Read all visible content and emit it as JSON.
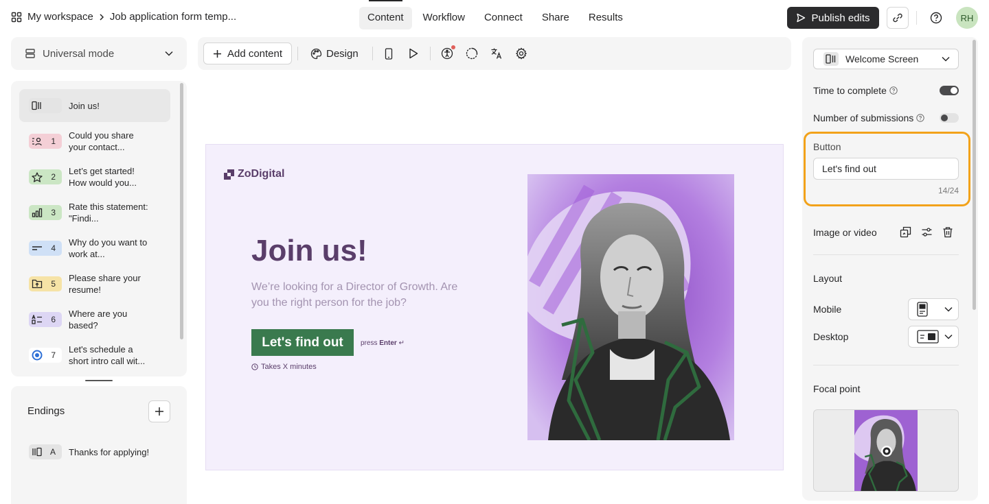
{
  "breadcrumb": {
    "workspace": "My workspace",
    "form": "Job application form temp..."
  },
  "nav": {
    "tabs": [
      "Content",
      "Workflow",
      "Connect",
      "Share",
      "Results"
    ],
    "active": "Content"
  },
  "header": {
    "publish_label": "Publish edits",
    "avatar_initials": "RH"
  },
  "left": {
    "mode_label": "Universal mode",
    "questions": [
      {
        "num": "",
        "text": "Join us!",
        "badge_color": "#e4e4e4",
        "icon": "welcome-screen-icon"
      },
      {
        "num": "1",
        "text": "Could you share your contact...",
        "badge_color": "#f4cfd6",
        "icon": "contact-info-icon"
      },
      {
        "num": "2",
        "text": "Let’s get started! How would you...",
        "badge_color": "#cbe6c4",
        "icon": "star-rating-icon"
      },
      {
        "num": "3",
        "text": "Rate this statement: \"Findi...",
        "badge_color": "#cbe6c4",
        "icon": "opinion-scale-icon"
      },
      {
        "num": "4",
        "text": "Why do you want to work at...",
        "badge_color": "#cfe0f6",
        "icon": "short-text-icon"
      },
      {
        "num": "5",
        "text": "Please share your resume!",
        "badge_color": "#f6e3a6",
        "icon": "file-upload-icon"
      },
      {
        "num": "6",
        "text": "Where are you based?",
        "badge_color": "#ddd6f4",
        "icon": "dropdown-icon"
      },
      {
        "num": "7",
        "text": "Let's schedule a short intro call wit...",
        "badge_color": "#ffffff",
        "icon": "calendly-icon"
      }
    ],
    "endings_title": "Endings",
    "ending": {
      "letter": "A",
      "text": "Thanks for applying!"
    }
  },
  "toolbar": {
    "add_content_label": "Add content",
    "design_label": "Design"
  },
  "canvas": {
    "logo_text": "ZoDigital",
    "headline": "Join us!",
    "subtitle": "We’re looking for a Director of Growth. Are you the right person for the job?",
    "cta_label": "Let's find out",
    "press_prefix": "press",
    "press_key": "Enter",
    "takes_label": "Takes X minutes",
    "background_color": "#f4effc",
    "accent_color": "#5a3e6a",
    "button_color": "#3a7a4e"
  },
  "right": {
    "screen_type": "Welcome Screen",
    "time_to_complete_label": "Time to complete",
    "time_to_complete_on": true,
    "submissions_label": "Number of submissions",
    "submissions_on": false,
    "button_label": "Button",
    "button_value": "Let's find out",
    "button_counter": "14/24",
    "image_label": "Image or video",
    "layout_title": "Layout",
    "mobile_label": "Mobile",
    "desktop_label": "Desktop",
    "focal_title": "Focal point"
  },
  "colors": {
    "highlight": "#f2a21a",
    "publish_bg": "#2b2b2d"
  }
}
